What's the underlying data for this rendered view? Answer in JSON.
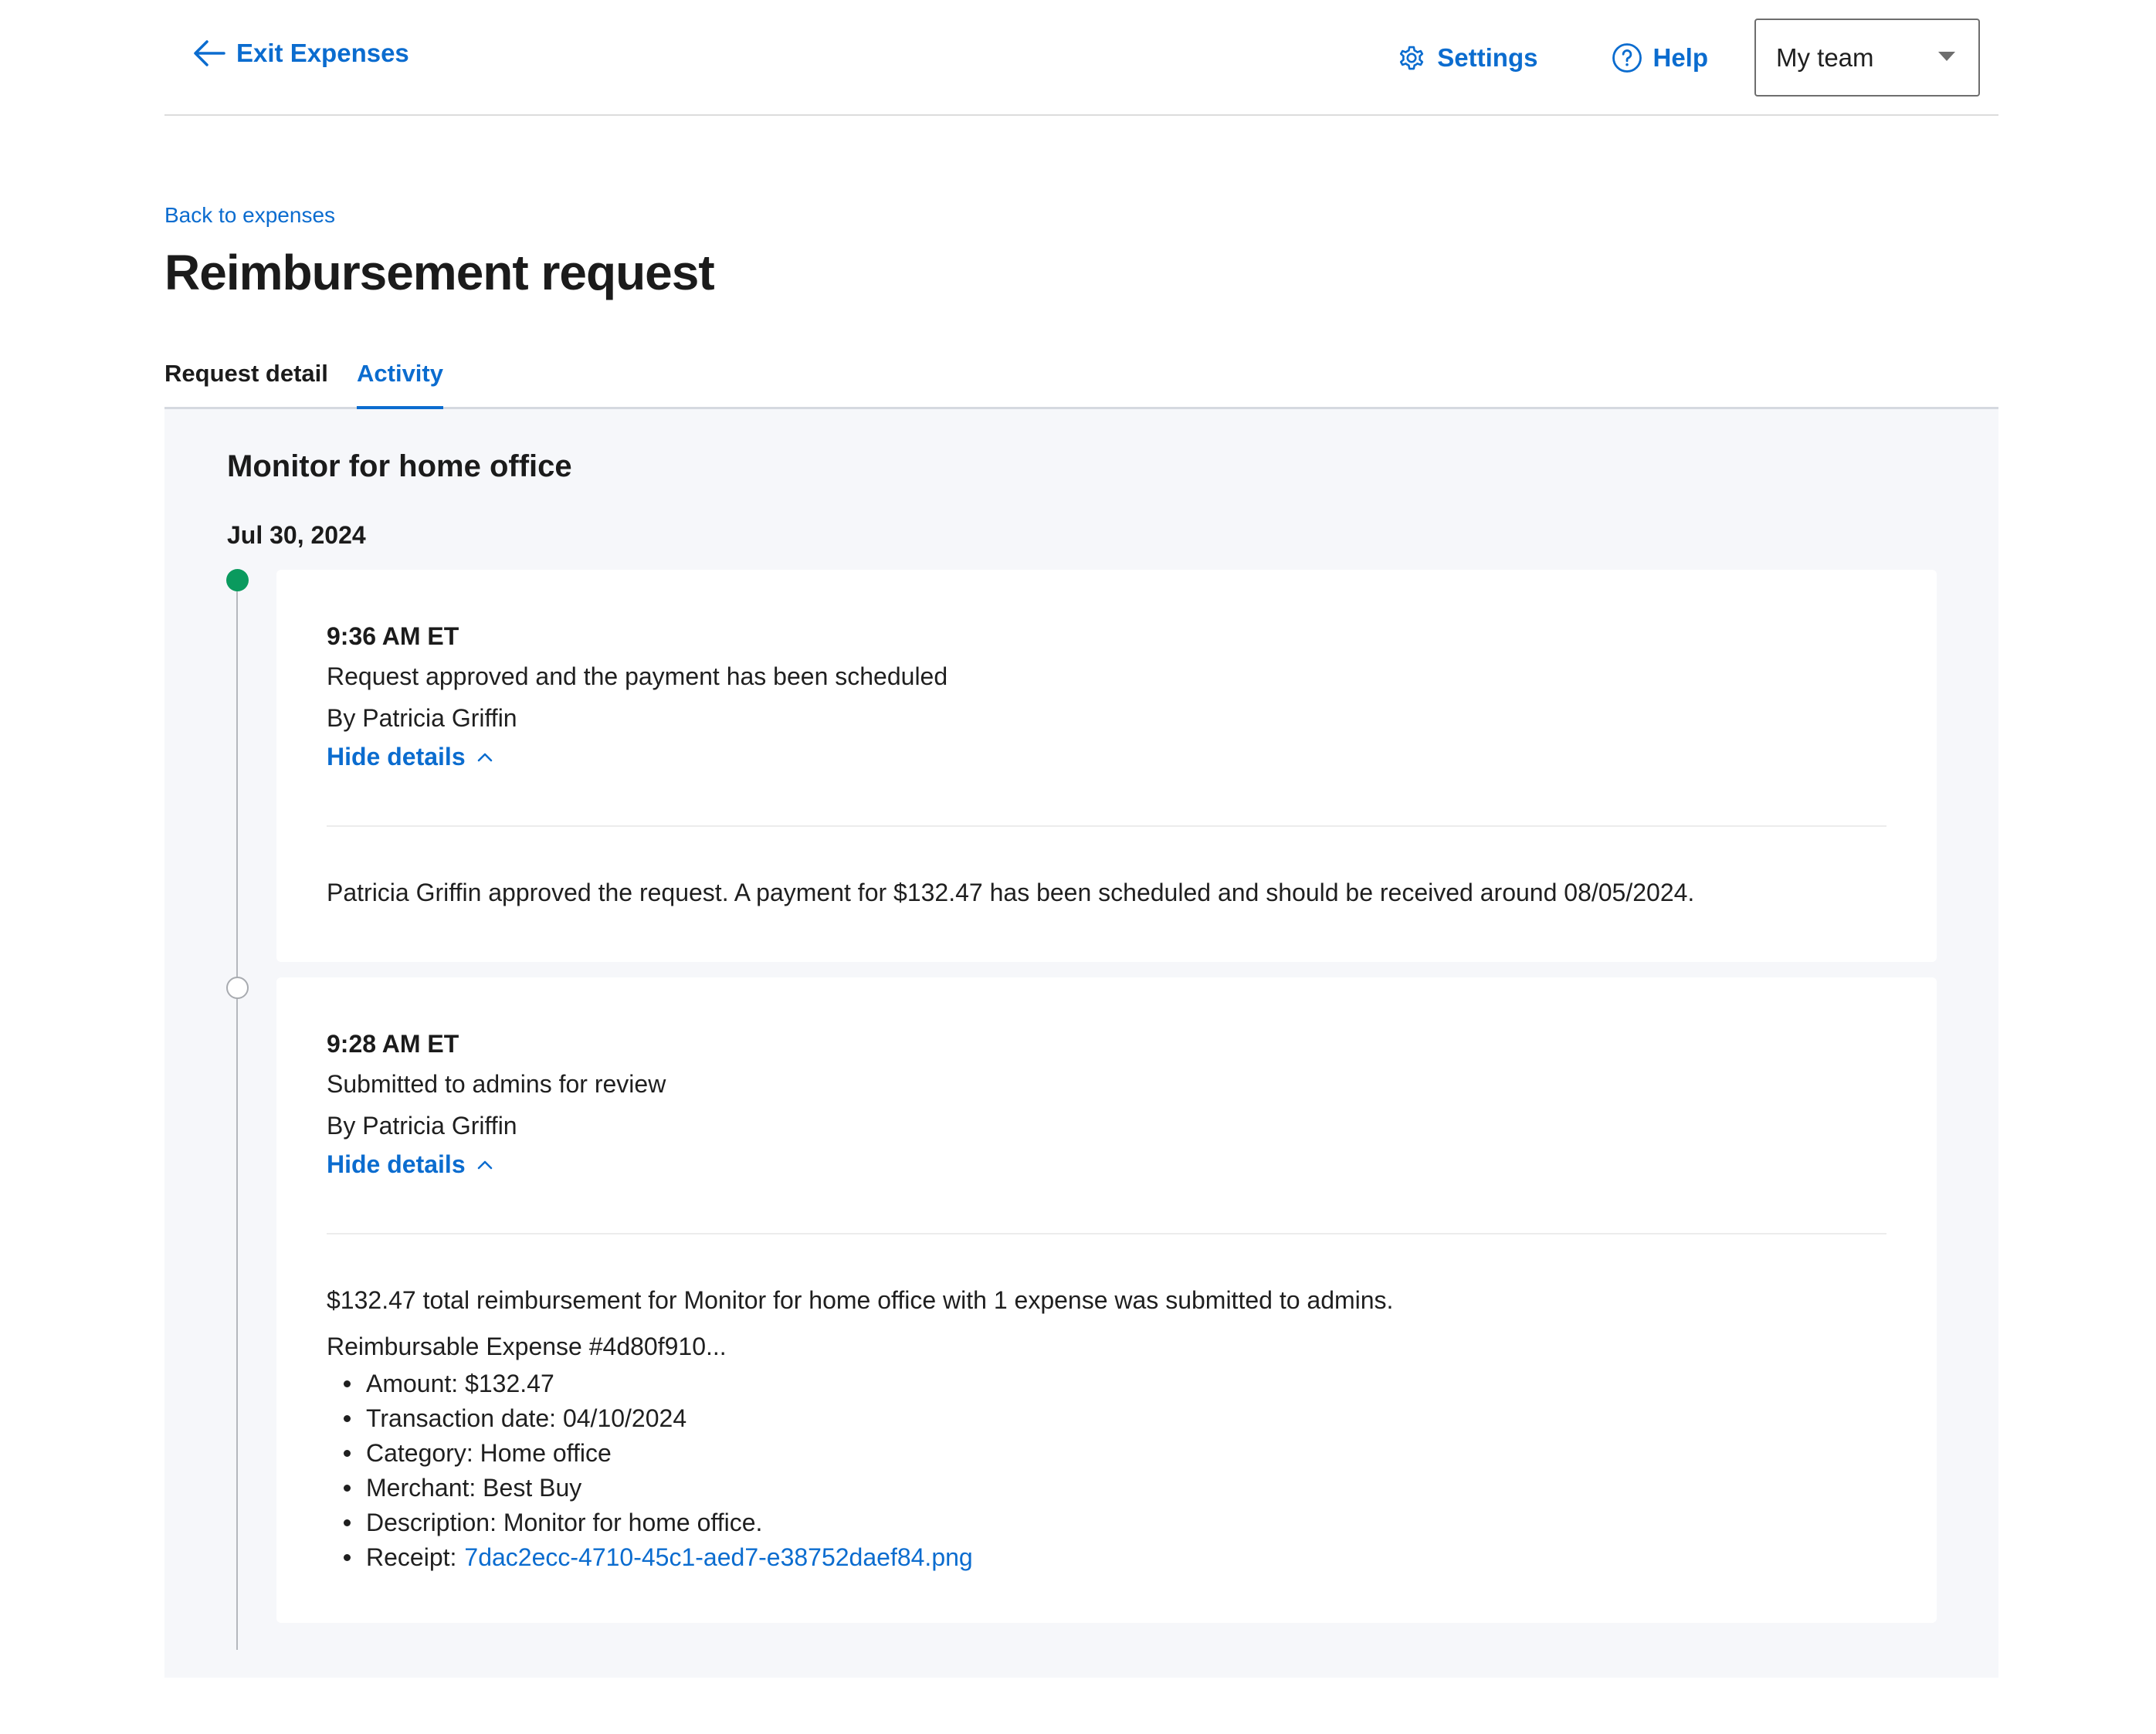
{
  "header": {
    "exit_label": "Exit Expenses",
    "settings_label": "Settings",
    "help_label": "Help",
    "team_select_value": "My team"
  },
  "nav": {
    "back_link": "Back to expenses"
  },
  "page": {
    "title": "Reimbursement request"
  },
  "tabs": [
    {
      "label": "Request detail",
      "active": false
    },
    {
      "label": "Activity",
      "active": true
    }
  ],
  "activity": {
    "request_title": "Monitor for home office",
    "date": "Jul 30, 2024",
    "events": [
      {
        "time": "9:36 AM ET",
        "action": "Request approved and the payment has been scheduled",
        "by": "By Patricia Griffin",
        "toggle_label": "Hide details",
        "details": "Patricia Griffin approved the request. A payment for $132.47 has been scheduled and should be received around 08/05/2024.",
        "status_color": "#0a9a5e"
      },
      {
        "time": "9:28 AM ET",
        "action": "Submitted to admins for review",
        "by": "By Patricia Griffin",
        "toggle_label": "Hide details",
        "details": "$132.47 total reimbursement for Monitor for home office with 1 expense was submitted to admins.",
        "expense": {
          "title": "Reimbursable Expense #4d80f910...",
          "items": [
            "Amount: $132.47",
            "Transaction date: 04/10/2024",
            "Category: Home office",
            "Merchant: Best Buy",
            "Description: Monitor for home office."
          ],
          "receipt_label": "Receipt:",
          "receipt_file": "7dac2ecc-4710-45c1-aed7-e38752daef84.png"
        }
      }
    ]
  },
  "colors": {
    "accent": "#0b6ccf",
    "success": "#0a9a5e",
    "panel_bg": "#f6f7fa"
  },
  "icons": {
    "exit": "arrow-left-icon",
    "settings": "gear-icon",
    "help": "question-circle-icon",
    "dropdown": "caret-down-icon",
    "toggle": "chevron-up-icon"
  }
}
